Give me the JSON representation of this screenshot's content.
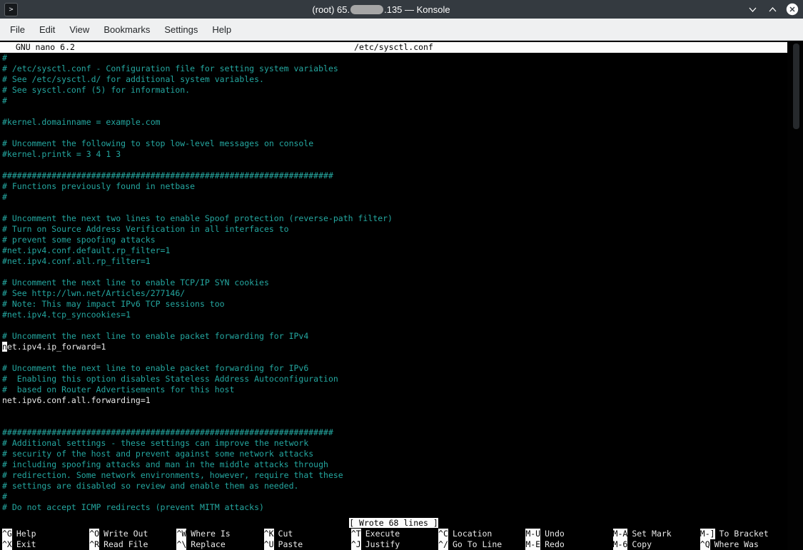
{
  "colors": {
    "titlebar_bg": "#343a40",
    "menubar_bg": "#eff0f1",
    "terminal_bg": "#000000",
    "comment_text": "#24a7a0",
    "plain_text": "#e9e9e9",
    "inverse_bg": "#fcfcfc",
    "inverse_fg": "#000000"
  },
  "titlebar": {
    "title_prefix": "(root) 65.",
    "title_suffix": ".135 — Konsole"
  },
  "menubar": {
    "items": [
      "File",
      "Edit",
      "View",
      "Bookmarks",
      "Settings",
      "Help"
    ]
  },
  "nano": {
    "header": {
      "app": "  GNU nano 6.2",
      "file": "/etc/sysctl.conf"
    },
    "status": "[ Wrote 68 lines ]",
    "lines": [
      {
        "text": "#",
        "type": "comment"
      },
      {
        "text": "# /etc/sysctl.conf - Configuration file for setting system variables",
        "type": "comment"
      },
      {
        "text": "# See /etc/sysctl.d/ for additional system variables.",
        "type": "comment"
      },
      {
        "text": "# See sysctl.conf (5) for information.",
        "type": "comment"
      },
      {
        "text": "#",
        "type": "comment"
      },
      {
        "text": "",
        "type": "comment"
      },
      {
        "text": "#kernel.domainname = example.com",
        "type": "comment"
      },
      {
        "text": "",
        "type": "comment"
      },
      {
        "text": "# Uncomment the following to stop low-level messages on console",
        "type": "comment"
      },
      {
        "text": "#kernel.printk = 3 4 1 3",
        "type": "comment"
      },
      {
        "text": "",
        "type": "comment"
      },
      {
        "text": "###################################################################",
        "type": "comment"
      },
      {
        "text": "# Functions previously found in netbase",
        "type": "comment"
      },
      {
        "text": "#",
        "type": "comment"
      },
      {
        "text": "",
        "type": "comment"
      },
      {
        "text": "# Uncomment the next two lines to enable Spoof protection (reverse-path filter)",
        "type": "comment"
      },
      {
        "text": "# Turn on Source Address Verification in all interfaces to",
        "type": "comment"
      },
      {
        "text": "# prevent some spoofing attacks",
        "type": "comment"
      },
      {
        "text": "#net.ipv4.conf.default.rp_filter=1",
        "type": "comment"
      },
      {
        "text": "#net.ipv4.conf.all.rp_filter=1",
        "type": "comment"
      },
      {
        "text": "",
        "type": "comment"
      },
      {
        "text": "# Uncomment the next line to enable TCP/IP SYN cookies",
        "type": "comment"
      },
      {
        "text": "# See http://lwn.net/Articles/277146/",
        "type": "comment"
      },
      {
        "text": "# Note: This may impact IPv6 TCP sessions too",
        "type": "comment"
      },
      {
        "text": "#net.ipv4.tcp_syncookies=1",
        "type": "comment"
      },
      {
        "text": "",
        "type": "comment"
      },
      {
        "text": "# Uncomment the next line to enable packet forwarding for IPv4",
        "type": "comment"
      },
      {
        "text": "net.ipv4.ip_forward=1",
        "type": "plain",
        "cursor": true
      },
      {
        "text": "",
        "type": "comment"
      },
      {
        "text": "# Uncomment the next line to enable packet forwarding for IPv6",
        "type": "comment"
      },
      {
        "text": "#  Enabling this option disables Stateless Address Autoconfiguration",
        "type": "comment"
      },
      {
        "text": "#  based on Router Advertisements for this host",
        "type": "comment"
      },
      {
        "text": "net.ipv6.conf.all.forwarding=1",
        "type": "plain"
      },
      {
        "text": "",
        "type": "comment"
      },
      {
        "text": "",
        "type": "comment"
      },
      {
        "text": "###################################################################",
        "type": "comment"
      },
      {
        "text": "# Additional settings - these settings can improve the network",
        "type": "comment"
      },
      {
        "text": "# security of the host and prevent against some network attacks",
        "type": "comment"
      },
      {
        "text": "# including spoofing attacks and man in the middle attacks through",
        "type": "comment"
      },
      {
        "text": "# redirection. Some network environments, however, require that these",
        "type": "comment"
      },
      {
        "text": "# settings are disabled so review and enable them as needed.",
        "type": "comment"
      },
      {
        "text": "#",
        "type": "comment"
      },
      {
        "text": "# Do not accept ICMP redirects (prevent MITM attacks)",
        "type": "comment"
      }
    ],
    "shortcuts": {
      "row1": [
        {
          "key": "^G",
          "label": "Help"
        },
        {
          "key": "^O",
          "label": "Write Out"
        },
        {
          "key": "^W",
          "label": "Where Is"
        },
        {
          "key": "^K",
          "label": "Cut"
        },
        {
          "key": "^T",
          "label": "Execute"
        },
        {
          "key": "^C",
          "label": "Location"
        },
        {
          "key": "M-U",
          "label": "Undo"
        },
        {
          "key": "M-A",
          "label": "Set Mark"
        },
        {
          "key": "M-]",
          "label": "To Bracket"
        }
      ],
      "row2": [
        {
          "key": "^X",
          "label": "Exit"
        },
        {
          "key": "^R",
          "label": "Read File"
        },
        {
          "key": "^\\",
          "label": "Replace"
        },
        {
          "key": "^U",
          "label": "Paste"
        },
        {
          "key": "^J",
          "label": "Justify"
        },
        {
          "key": "^/",
          "label": "Go To Line"
        },
        {
          "key": "M-E",
          "label": "Redo"
        },
        {
          "key": "M-6",
          "label": "Copy"
        },
        {
          "key": "^Q",
          "label": "Where Was"
        }
      ]
    }
  }
}
